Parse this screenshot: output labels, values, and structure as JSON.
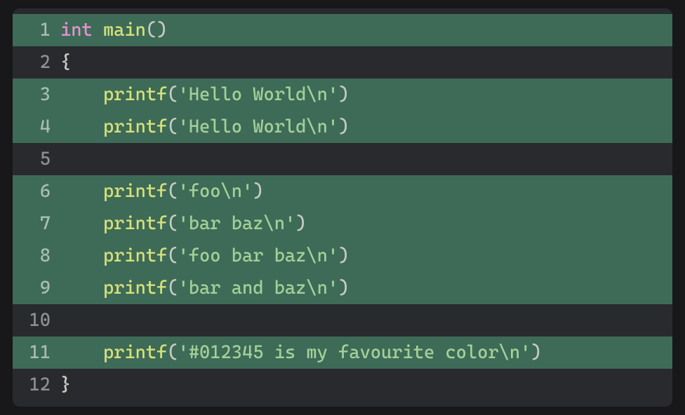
{
  "code": {
    "lines": [
      {
        "num": "1",
        "hl": true,
        "indent": "",
        "tokens": [
          {
            "cls": "tok-type",
            "text": "int"
          },
          {
            "cls": "tok-plain",
            "text": " "
          },
          {
            "cls": "tok-func",
            "text": "main"
          },
          {
            "cls": "tok-paren",
            "text": "()"
          }
        ]
      },
      {
        "num": "2",
        "hl": false,
        "indent": "",
        "tokens": [
          {
            "cls": "tok-brace",
            "text": "{"
          }
        ]
      },
      {
        "num": "3",
        "hl": true,
        "indent": "    ",
        "tokens": [
          {
            "cls": "tok-func",
            "text": "printf"
          },
          {
            "cls": "tok-paren",
            "text": "("
          },
          {
            "cls": "tok-string",
            "text": "'Hello World\\n'"
          },
          {
            "cls": "tok-paren",
            "text": ")"
          }
        ]
      },
      {
        "num": "4",
        "hl": true,
        "indent": "    ",
        "tokens": [
          {
            "cls": "tok-func",
            "text": "printf"
          },
          {
            "cls": "tok-paren",
            "text": "("
          },
          {
            "cls": "tok-string",
            "text": "'Hello World\\n'"
          },
          {
            "cls": "tok-paren",
            "text": ")"
          }
        ]
      },
      {
        "num": "5",
        "hl": false,
        "indent": "",
        "tokens": []
      },
      {
        "num": "6",
        "hl": true,
        "indent": "    ",
        "tokens": [
          {
            "cls": "tok-func",
            "text": "printf"
          },
          {
            "cls": "tok-paren",
            "text": "("
          },
          {
            "cls": "tok-string",
            "text": "'foo\\n'"
          },
          {
            "cls": "tok-paren",
            "text": ")"
          }
        ]
      },
      {
        "num": "7",
        "hl": true,
        "indent": "    ",
        "tokens": [
          {
            "cls": "tok-func",
            "text": "printf"
          },
          {
            "cls": "tok-paren",
            "text": "("
          },
          {
            "cls": "tok-string",
            "text": "'bar baz\\n'"
          },
          {
            "cls": "tok-paren",
            "text": ")"
          }
        ]
      },
      {
        "num": "8",
        "hl": true,
        "indent": "    ",
        "tokens": [
          {
            "cls": "tok-func",
            "text": "printf"
          },
          {
            "cls": "tok-paren",
            "text": "("
          },
          {
            "cls": "tok-string",
            "text": "'foo bar baz\\n'"
          },
          {
            "cls": "tok-paren",
            "text": ")"
          }
        ]
      },
      {
        "num": "9",
        "hl": true,
        "indent": "    ",
        "tokens": [
          {
            "cls": "tok-func",
            "text": "printf"
          },
          {
            "cls": "tok-paren",
            "text": "("
          },
          {
            "cls": "tok-string",
            "text": "'bar and baz\\n'"
          },
          {
            "cls": "tok-paren",
            "text": ")"
          }
        ]
      },
      {
        "num": "10",
        "hl": false,
        "indent": "",
        "tokens": []
      },
      {
        "num": "11",
        "hl": true,
        "indent": "    ",
        "tokens": [
          {
            "cls": "tok-func",
            "text": "printf"
          },
          {
            "cls": "tok-paren",
            "text": "("
          },
          {
            "cls": "tok-string",
            "text": "'#012345 is my favourite color\\n'"
          },
          {
            "cls": "tok-paren",
            "text": ")"
          }
        ]
      },
      {
        "num": "12",
        "hl": false,
        "indent": "",
        "tokens": [
          {
            "cls": "tok-brace",
            "text": "}"
          }
        ]
      }
    ]
  }
}
